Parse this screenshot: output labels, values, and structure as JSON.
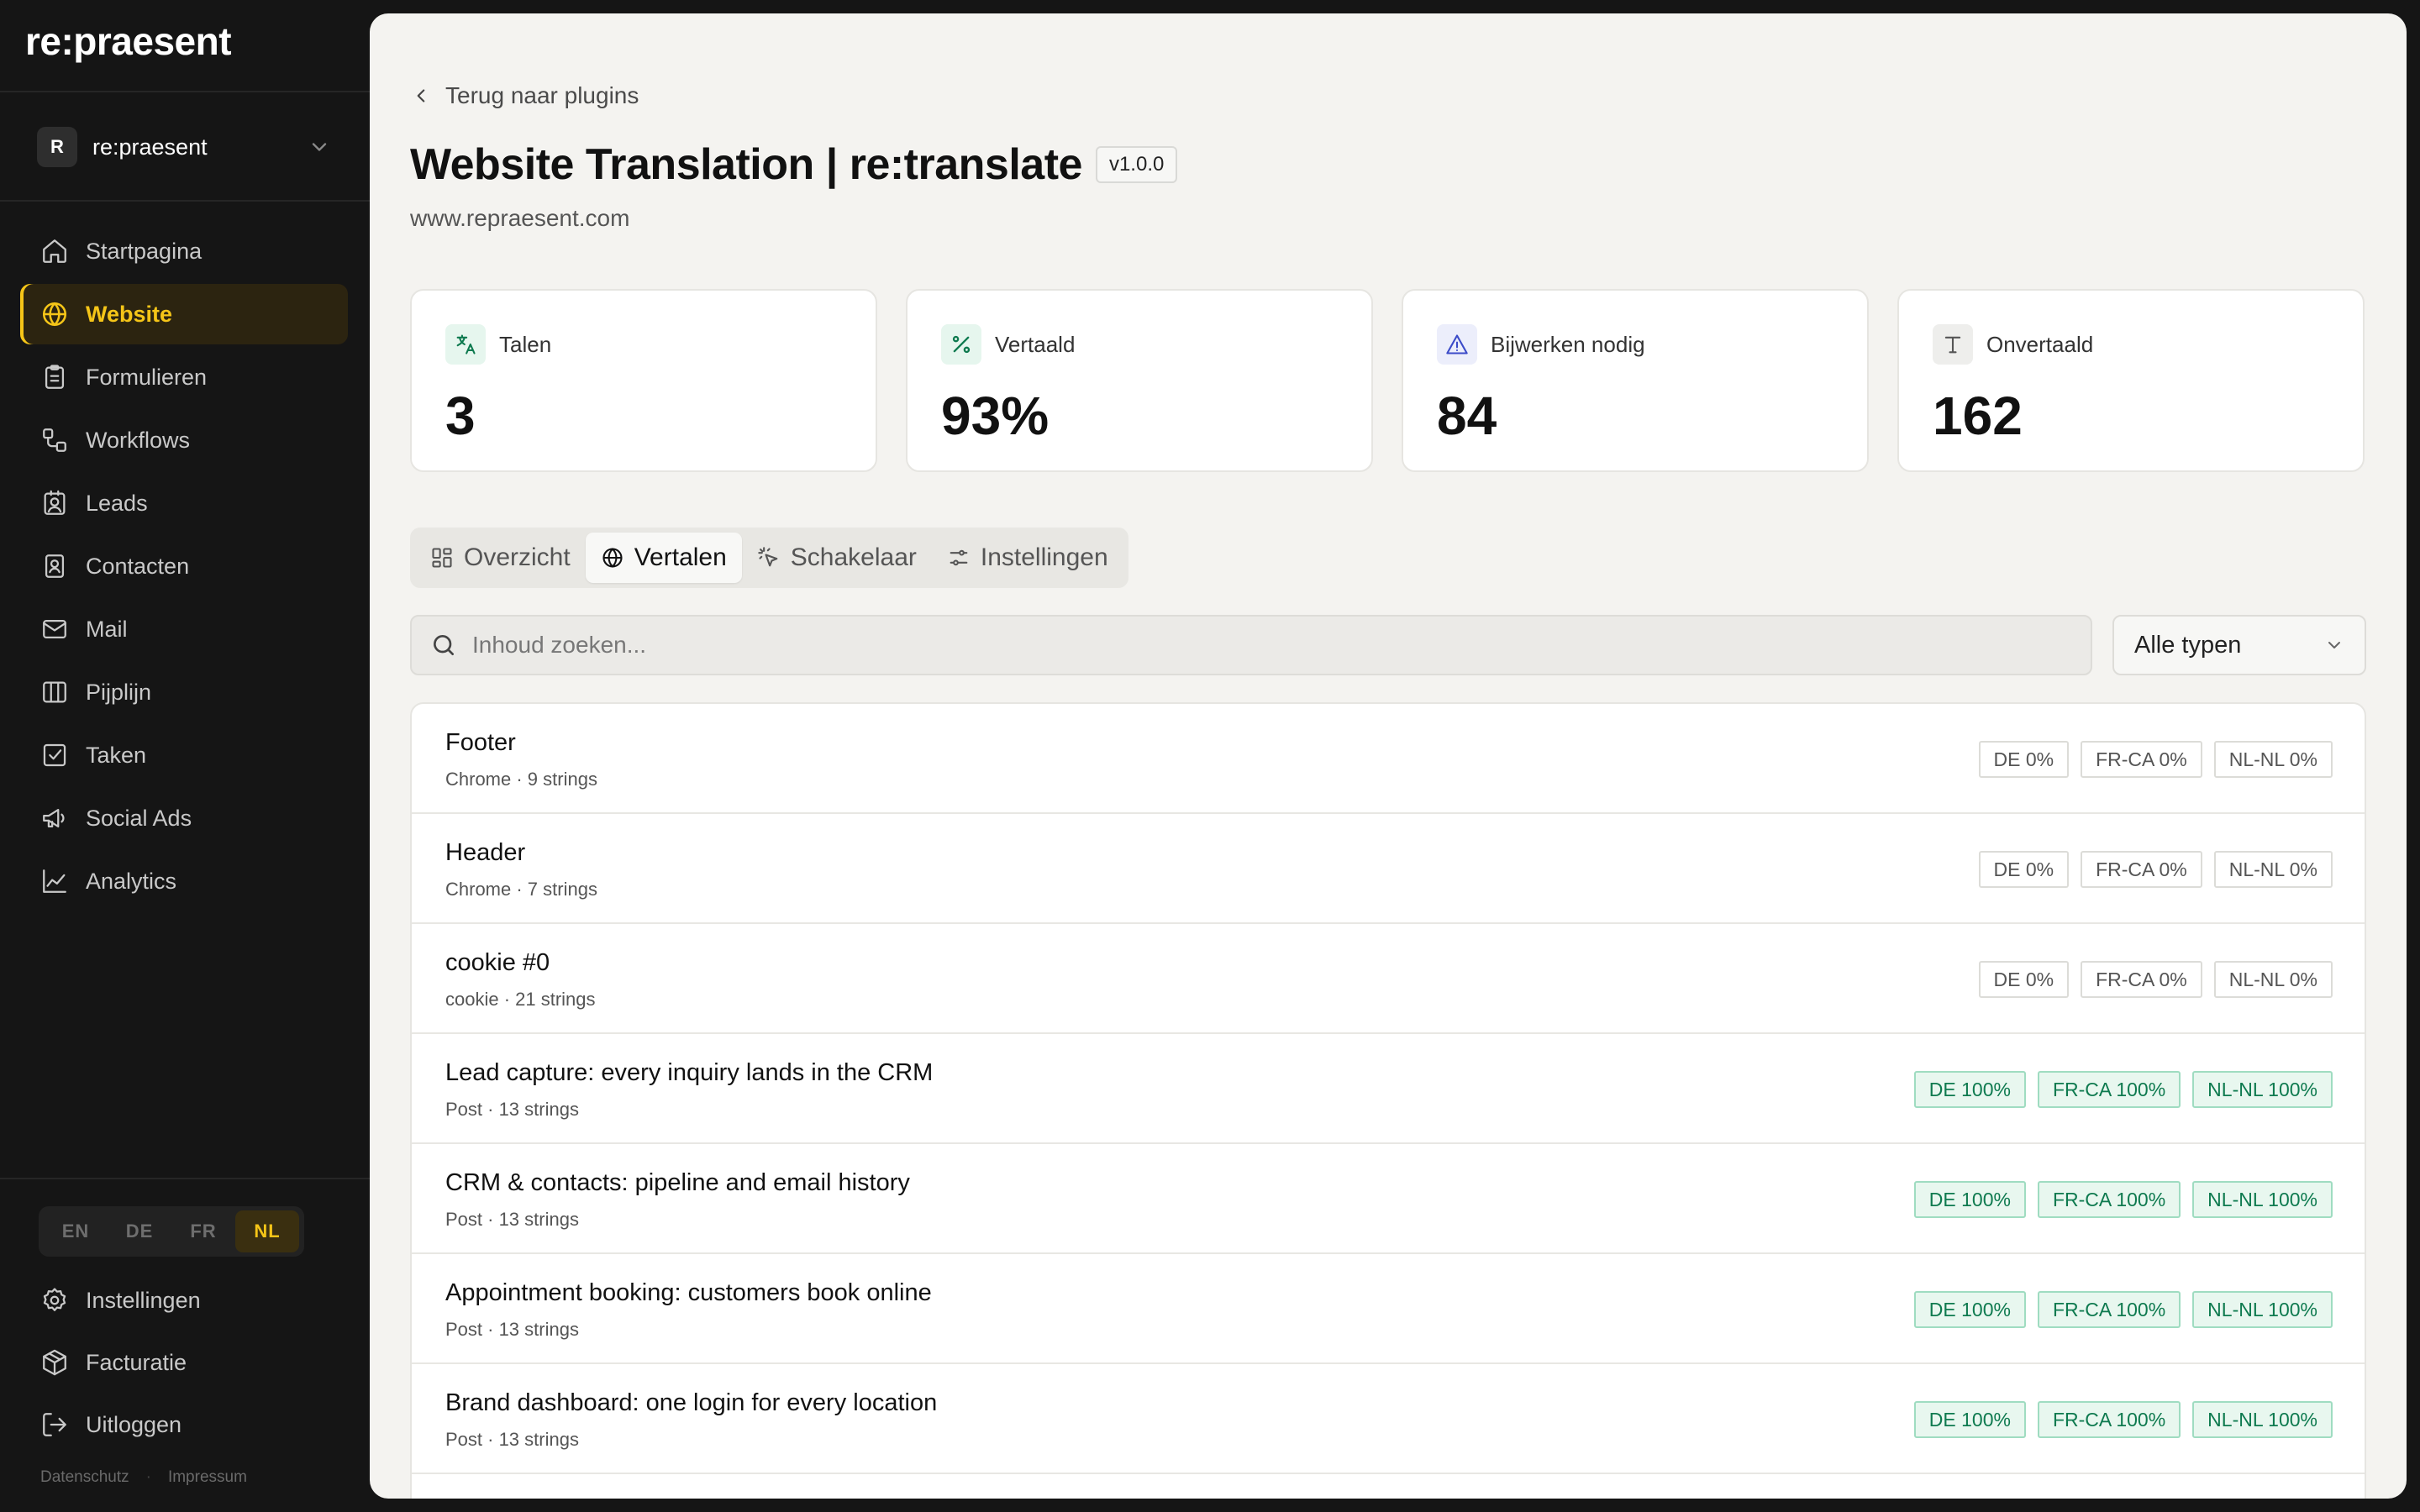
{
  "app": {
    "logo": "re:praesent",
    "workspace": {
      "avatar_letter": "R",
      "name": "re:praesent"
    }
  },
  "sidebar": {
    "items": [
      {
        "label": "Startpagina",
        "icon": "home-icon"
      },
      {
        "label": "Website",
        "icon": "globe-icon",
        "active": true
      },
      {
        "label": "Formulieren",
        "icon": "clipboard-icon"
      },
      {
        "label": "Workflows",
        "icon": "workflow-icon"
      },
      {
        "label": "Leads",
        "icon": "lead-icon"
      },
      {
        "label": "Contacten",
        "icon": "contact-icon"
      },
      {
        "label": "Mail",
        "icon": "mail-icon"
      },
      {
        "label": "Pijplijn",
        "icon": "columns-icon"
      },
      {
        "label": "Taken",
        "icon": "checkbox-icon"
      },
      {
        "label": "Social Ads",
        "icon": "megaphone-icon"
      },
      {
        "label": "Analytics",
        "icon": "chart-icon"
      }
    ],
    "languages": [
      "EN",
      "DE",
      "FR",
      "NL"
    ],
    "active_language": "NL",
    "bottom": {
      "settings": "Instellingen",
      "billing": "Facturatie",
      "logout": "Uitloggen"
    },
    "legal": {
      "privacy": "Datenschutz",
      "imprint": "Impressum"
    }
  },
  "main": {
    "back_label": "Terug naar plugins",
    "title": "Website Translation | re:translate",
    "version": "v1.0.0",
    "domain": "www.repraesent.com",
    "stats": [
      {
        "label": "Talen",
        "value": "3",
        "icon": "translate-icon",
        "color": "#e6f6ee"
      },
      {
        "label": "Vertaald",
        "value": "93%",
        "icon": "percent-icon",
        "color": "#e6f6ee"
      },
      {
        "label": "Bijwerken nodig",
        "value": "84",
        "icon": "warning-icon",
        "color": "#eceefb"
      },
      {
        "label": "Onvertaald",
        "value": "162",
        "icon": "text-icon",
        "color": "#eeeeec"
      }
    ],
    "tabs": [
      {
        "label": "Overzicht",
        "icon": "grid-icon"
      },
      {
        "label": "Vertalen",
        "icon": "globe-icon",
        "active": true
      },
      {
        "label": "Schakelaar",
        "icon": "click-icon"
      },
      {
        "label": "Instellingen",
        "icon": "sliders-icon"
      }
    ],
    "search_placeholder": "Inhoud zoeken...",
    "type_filter": "Alle typen",
    "rows": [
      {
        "title": "Footer",
        "sub": "Chrome · 9 strings",
        "badges": [
          {
            "label": "DE 0%",
            "done": false
          },
          {
            "label": "FR-CA 0%",
            "done": false
          },
          {
            "label": "NL-NL 0%",
            "done": false
          }
        ]
      },
      {
        "title": "Header",
        "sub": "Chrome · 7 strings",
        "badges": [
          {
            "label": "DE 0%",
            "done": false
          },
          {
            "label": "FR-CA 0%",
            "done": false
          },
          {
            "label": "NL-NL 0%",
            "done": false
          }
        ]
      },
      {
        "title": "cookie #0",
        "sub": "cookie · 21 strings",
        "badges": [
          {
            "label": "DE 0%",
            "done": false
          },
          {
            "label": "FR-CA 0%",
            "done": false
          },
          {
            "label": "NL-NL 0%",
            "done": false
          }
        ]
      },
      {
        "title": "Lead capture: every inquiry lands in the CRM",
        "sub": "Post · 13 strings",
        "badges": [
          {
            "label": "DE 100%",
            "done": true
          },
          {
            "label": "FR-CA 100%",
            "done": true
          },
          {
            "label": "NL-NL 100%",
            "done": true
          }
        ]
      },
      {
        "title": "CRM & contacts: pipeline and email history",
        "sub": "Post · 13 strings",
        "badges": [
          {
            "label": "DE 100%",
            "done": true
          },
          {
            "label": "FR-CA 100%",
            "done": true
          },
          {
            "label": "NL-NL 100%",
            "done": true
          }
        ]
      },
      {
        "title": "Appointment booking: customers book online",
        "sub": "Post · 13 strings",
        "badges": [
          {
            "label": "DE 100%",
            "done": true
          },
          {
            "label": "FR-CA 100%",
            "done": true
          },
          {
            "label": "NL-NL 100%",
            "done": true
          }
        ]
      },
      {
        "title": "Brand dashboard: one login for every location",
        "sub": "Post · 13 strings",
        "badges": [
          {
            "label": "DE 100%",
            "done": true
          },
          {
            "label": "FR-CA 100%",
            "done": true
          },
          {
            "label": "NL-NL 100%",
            "done": true
          }
        ]
      }
    ]
  },
  "colors": {
    "accent": "#f5c518",
    "success": "#0e7a4f",
    "sidebar_bg": "#151515",
    "main_bg": "#f4f3f0"
  }
}
